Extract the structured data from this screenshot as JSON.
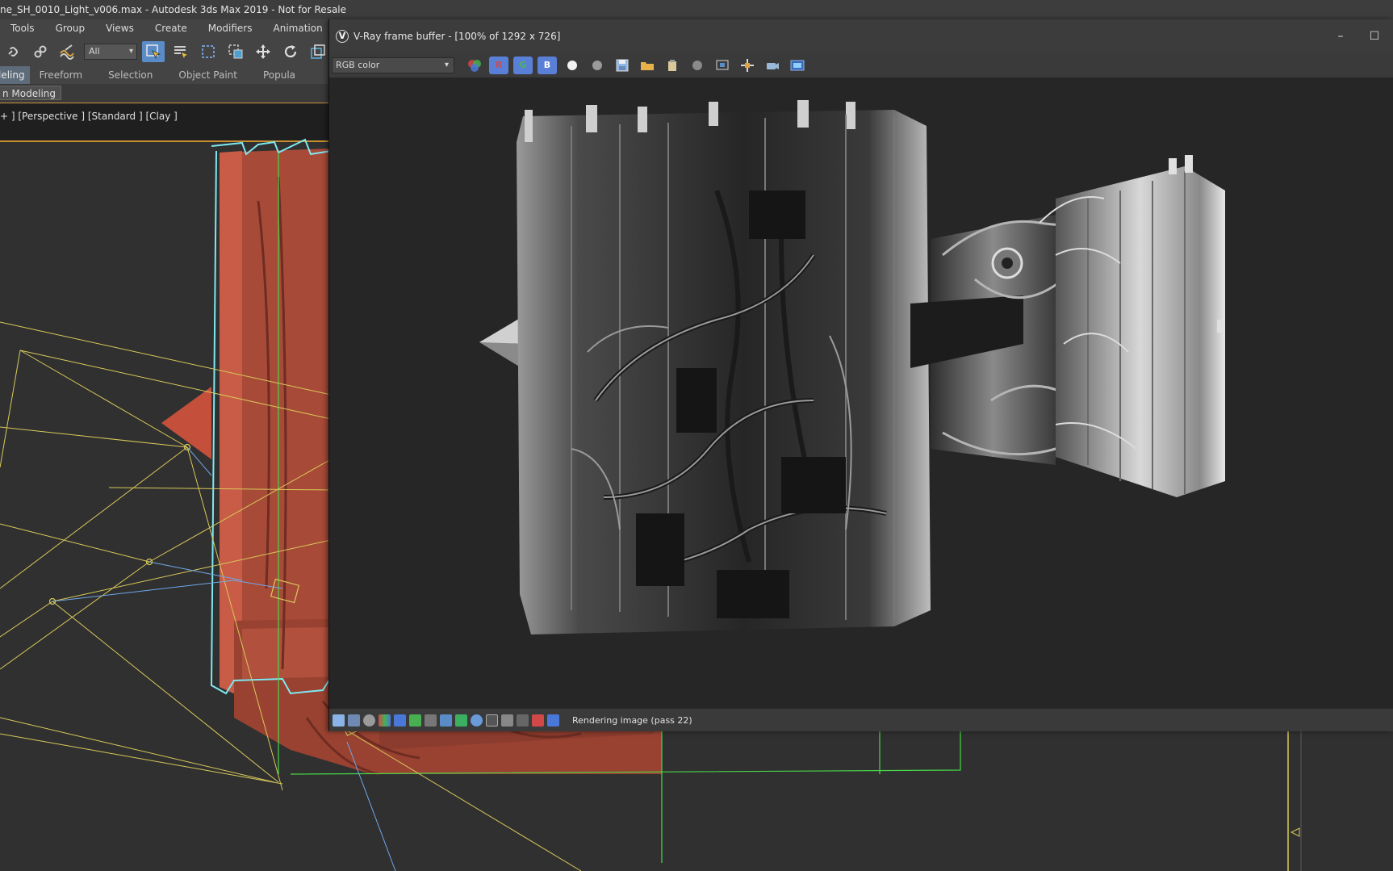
{
  "max_window": {
    "title": "ne_SH_0010_Light_v006.max - Autodesk 3ds Max 2019 - Not for Resale",
    "menu": [
      "Tools",
      "Group",
      "Views",
      "Create",
      "Modifiers",
      "Animation"
    ],
    "selection_filter": "All",
    "ribbon_tabs": [
      "leling",
      "Freeform",
      "Selection",
      "Object Paint",
      "Popula"
    ],
    "ribbon_sub_button": "n Modeling",
    "viewport_label": "+ ] [Perspective ] [Standard ] [Clay ]",
    "toolbar_icons": [
      "link-icon",
      "unlink-icon",
      "bind-spacewarp-icon",
      "select-object-icon",
      "select-by-name-icon",
      "rectangle-selection-icon",
      "window-crossing-icon",
      "move-icon",
      "rotate-icon",
      "scale-icon"
    ]
  },
  "vfb": {
    "title": "V-Ray frame buffer - [100% of 1292 x 726]",
    "channel": "RGB color",
    "channel_buttons": [
      "R",
      "G",
      "B"
    ],
    "status": "Rendering image (pass 22)",
    "window_controls": [
      "minimize",
      "maximize"
    ],
    "toolbar_icons": [
      "color-channels-icon",
      "white-circle-icon",
      "grey-circle-icon",
      "save-icon",
      "open-folder-icon",
      "clear-icon",
      "stop-circle-icon",
      "region-render-icon",
      "track-mouse-icon",
      "camera-icon",
      "lens-effects-icon"
    ]
  },
  "colors": {
    "max_bg": "#303030",
    "selection_outline": "#7fe8f0",
    "engine_clay": "#b3503e",
    "helper_lines": "#d8c95a",
    "accent_blue": "#5a8cc8"
  }
}
